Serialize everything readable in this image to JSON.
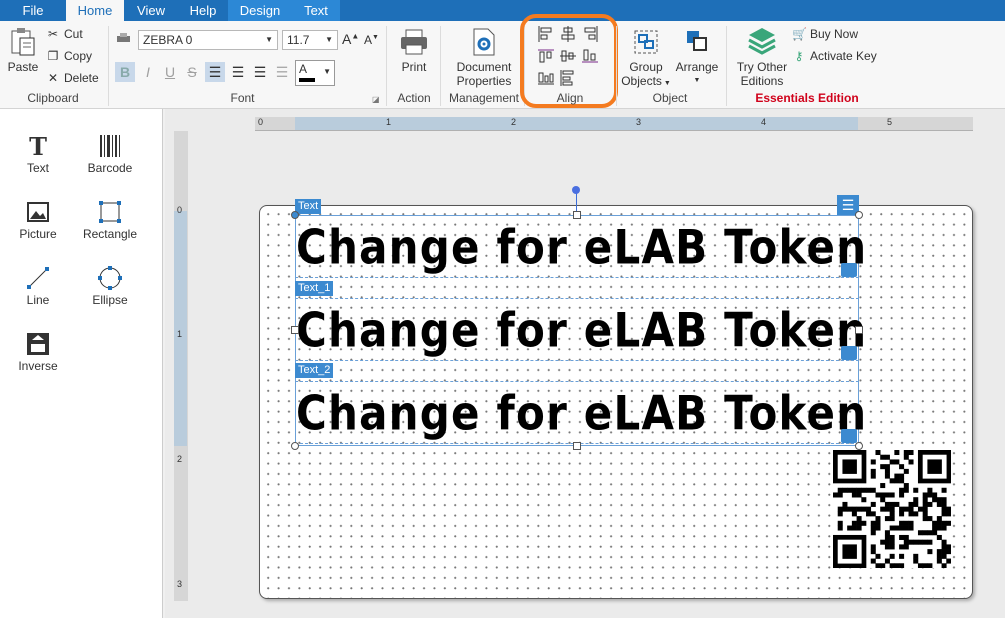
{
  "menu": {
    "tabs": [
      "File",
      "Home",
      "View",
      "Help"
    ],
    "context_tabs": [
      "Design",
      "Text"
    ]
  },
  "clipboard": {
    "paste": "Paste",
    "cut": "Cut",
    "copy": "Copy",
    "delete": "Delete",
    "group": "Clipboard"
  },
  "font": {
    "name": "ZEBRA 0",
    "size": "11.7",
    "group": "Font",
    "color_label": "A"
  },
  "action": {
    "print": "Print",
    "group": "Action"
  },
  "management": {
    "doc_props_1": "Document",
    "doc_props_2": "Properties",
    "group": "Management"
  },
  "align": {
    "group": "Align",
    "highlight_color": "#f47b20"
  },
  "object": {
    "group_objects_1": "Group",
    "group_objects_2": "Objects",
    "arrange": "Arrange",
    "group": "Object"
  },
  "editions": {
    "try_1": "Try Other",
    "try_2": "Editions",
    "buy": "Buy Now",
    "activate": "Activate Key",
    "edition": "Essentials Edition",
    "edition_color": "#d0021b"
  },
  "tools": [
    "Text",
    "Barcode",
    "Picture",
    "Rectangle",
    "Line",
    "Ellipse",
    "Inverse"
  ],
  "ruler": {
    "h_marks": [
      "0",
      "1",
      "2",
      "3",
      "4",
      "5"
    ],
    "v_marks": [
      "0",
      "1",
      "2",
      "3"
    ]
  },
  "label": {
    "objects": [
      {
        "tag": "Text",
        "text": "Change for eLAB Token"
      },
      {
        "tag": "Text_1",
        "text": "Change for eLAB Token"
      },
      {
        "tag": "Text_2",
        "text": "Change for eLAB Token"
      }
    ]
  },
  "colors": {
    "accent": "#1e6fb8",
    "selection": "#3c8ad0"
  }
}
